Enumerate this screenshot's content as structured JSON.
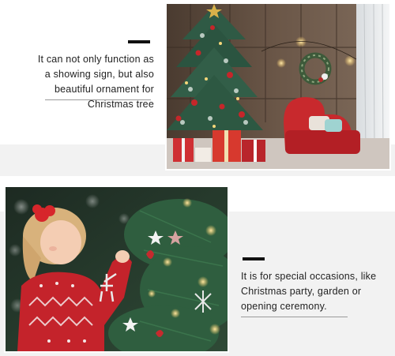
{
  "section_1": {
    "caption": "It can not only function as a showing sign, but also beautiful ornament for Christmas tree"
  },
  "section_2": {
    "caption": "It is for special occasions, like Christmas party, garden or opening ceremony."
  },
  "colors": {
    "accent": "#111111",
    "rule": "#9a9a9a",
    "panel_gray": "#f2f2f2",
    "text": "#222222"
  }
}
